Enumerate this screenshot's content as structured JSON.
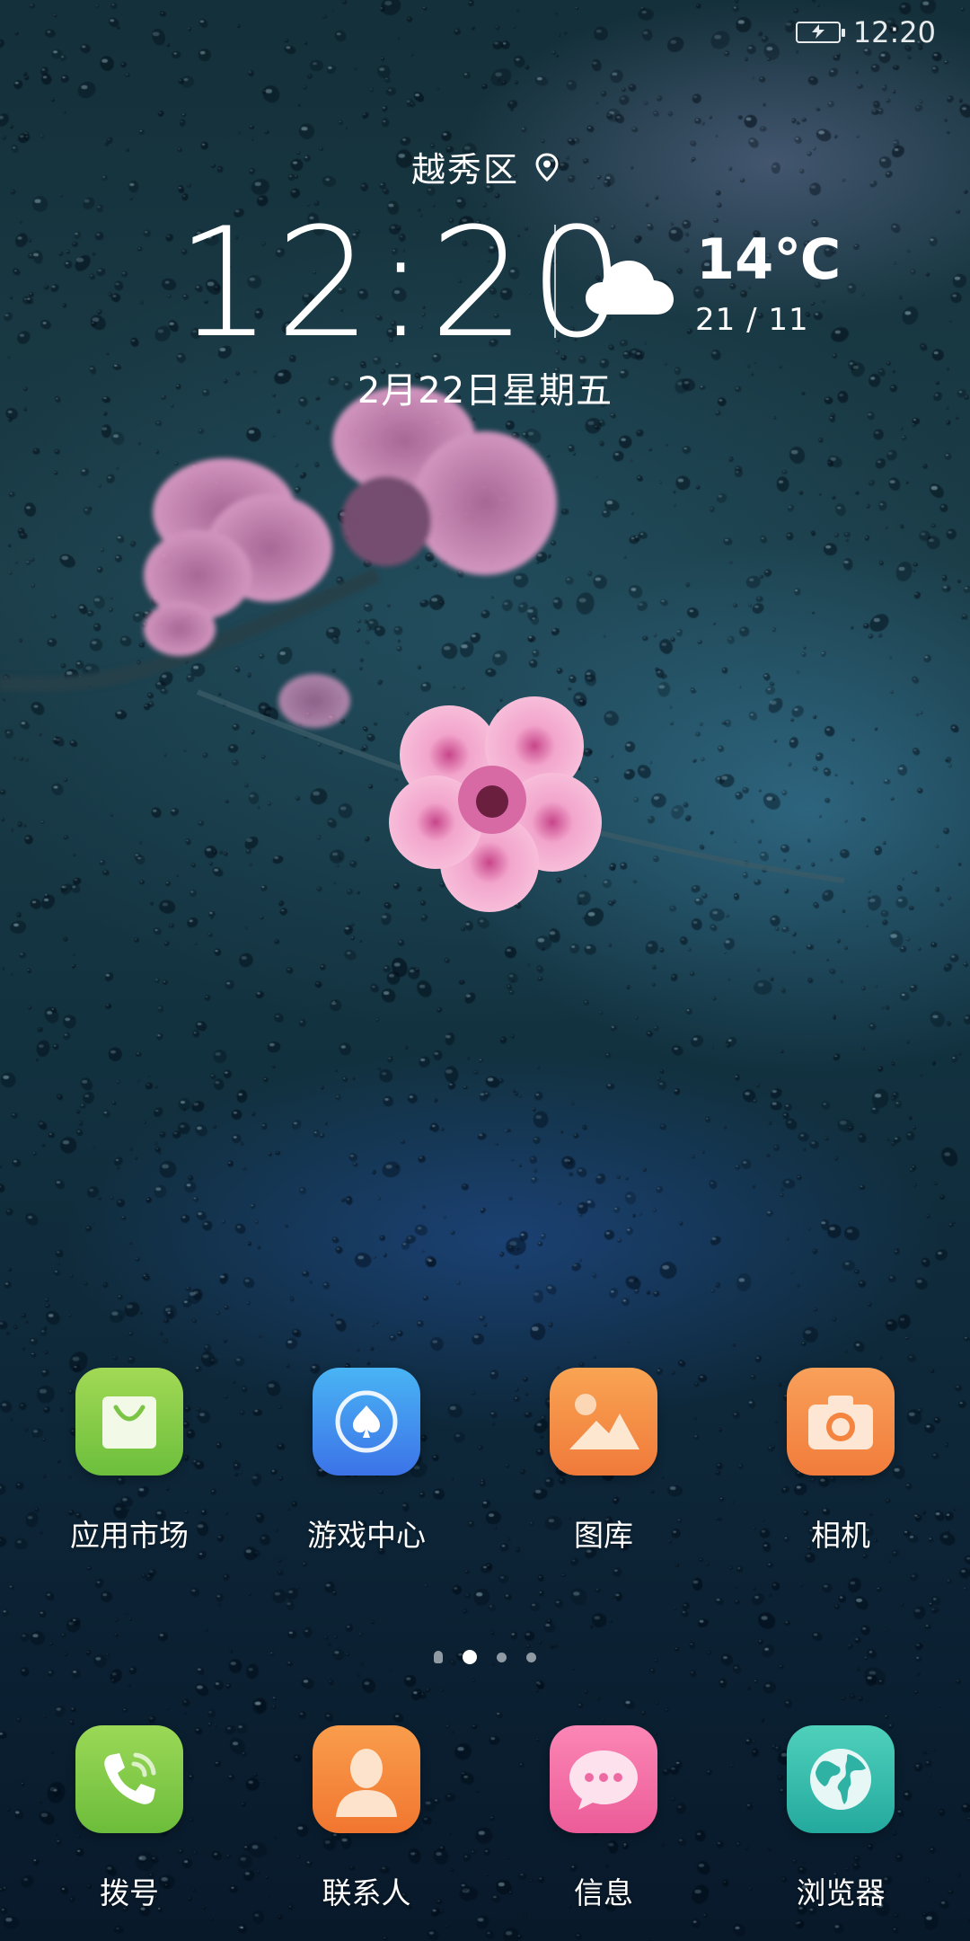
{
  "status_bar": {
    "time": "12:20"
  },
  "lock_widget": {
    "location": "越秀区",
    "time": "12:20",
    "temperature": "14℃",
    "temp_range": "21 / 11",
    "date": "2月22日星期五",
    "weather": "cloud-icon"
  },
  "apps_row": [
    {
      "label": "应用市场",
      "icon": "shopping-bag-icon",
      "color": "#8ed04c"
    },
    {
      "label": "游戏中心",
      "icon": "spade-icon",
      "color": "#3f8ef5"
    },
    {
      "label": "图库",
      "icon": "picture-icon",
      "color": "#f38b43"
    },
    {
      "label": "相机",
      "icon": "camera-icon",
      "color": "#f5853e"
    }
  ],
  "pager": {
    "current_page": 2,
    "pages": 4
  },
  "dock": [
    {
      "label": "拨号",
      "icon": "phone-icon",
      "color": "#84cc46"
    },
    {
      "label": "联系人",
      "icon": "contact-icon",
      "color": "#f58c3a"
    },
    {
      "label": "信息",
      "icon": "message-icon",
      "color": "#f06aa0"
    },
    {
      "label": "浏览器",
      "icon": "globe-icon",
      "color": "#32bfae"
    }
  ]
}
